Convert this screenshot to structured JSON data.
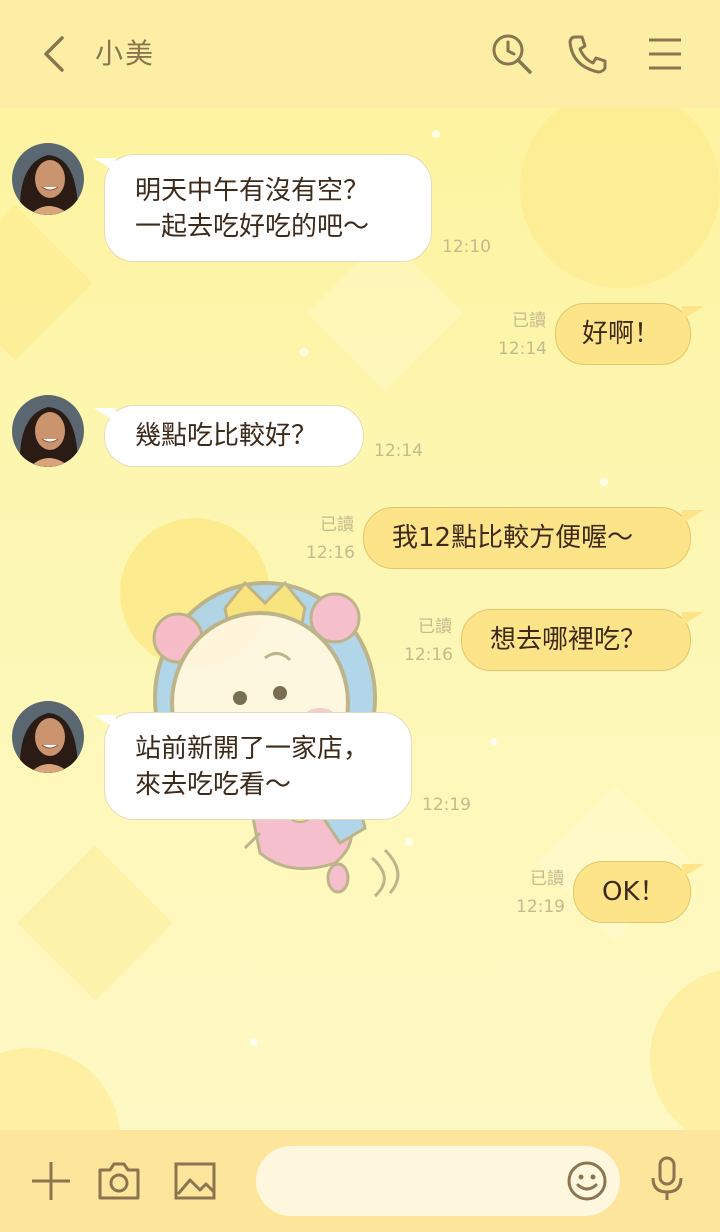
{
  "header": {
    "contact_name": "小美",
    "icons": [
      "back-arrow-icon",
      "search-clock-icon",
      "phone-icon",
      "menu-icon"
    ]
  },
  "messages": [
    {
      "direction": "incoming",
      "text": "明天中午有沒有空？\n一起去吃好吃的吧～",
      "time": "12:10"
    },
    {
      "direction": "outgoing",
      "text": "好啊！",
      "status": "已讀",
      "time": "12:14"
    },
    {
      "direction": "incoming",
      "text": "幾點吃比較好？",
      "time": "12:14"
    },
    {
      "direction": "outgoing",
      "text": "我12點比較方便喔～",
      "status": "已讀",
      "time": "12:16"
    },
    {
      "direction": "outgoing",
      "text": "想去哪裡吃？",
      "status": "已讀",
      "time": "12:16"
    },
    {
      "direction": "incoming",
      "text": "站前新開了一家店，\n來去吃吃看～",
      "time": "12:19"
    },
    {
      "direction": "outgoing",
      "text": "OK！",
      "status": "已讀",
      "time": "12:19"
    }
  ],
  "input_bar": {
    "icons": [
      "plus-icon",
      "camera-icon",
      "image-icon",
      "emoji-icon",
      "microphone-icon"
    ],
    "message_value": ""
  },
  "colors": {
    "header_bg": "#fdeea6",
    "chat_bg": "#fdf3a0",
    "outgoing_bubble": "#fde489",
    "incoming_bubble": "#ffffff",
    "icon": "#8a7550",
    "meta_text": "#c7b98d"
  }
}
